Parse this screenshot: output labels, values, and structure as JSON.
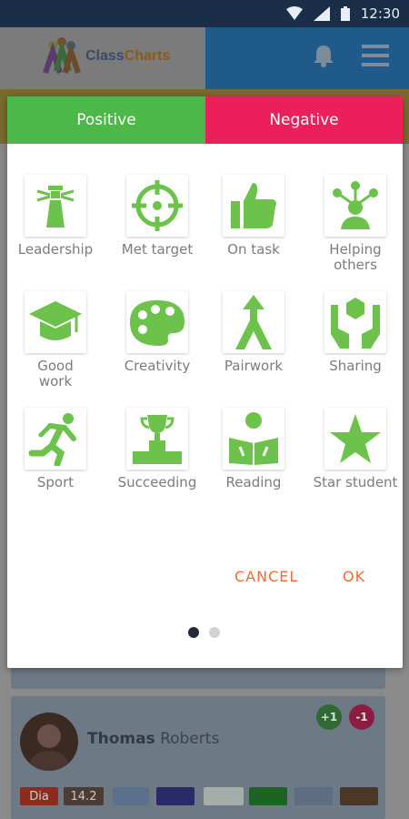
{
  "status_bar": {
    "time": "12:30"
  },
  "app_header": {
    "logo_class": "Class",
    "logo_charts": "Charts"
  },
  "dialog": {
    "tabs": [
      {
        "label": "Positive",
        "color": "#4cb847"
      },
      {
        "label": "Negative",
        "color": "#ea1f5c"
      }
    ],
    "behaviours": [
      {
        "label": "Leadership",
        "icon": "lighthouse-icon"
      },
      {
        "label": "Met target",
        "icon": "target-icon"
      },
      {
        "label": "On task",
        "icon": "thumbs-up-icon"
      },
      {
        "label": "Helping others",
        "icon": "people-network-icon"
      },
      {
        "label": "Good work",
        "icon": "graduation-cap-icon"
      },
      {
        "label": "Creativity",
        "icon": "palette-icon"
      },
      {
        "label": "Pairwork",
        "icon": "merging-arrows-icon"
      },
      {
        "label": "Sharing",
        "icon": "hands-icon"
      },
      {
        "label": "Sport",
        "icon": "runner-icon"
      },
      {
        "label": "Succeeding",
        "icon": "trophy-podium-icon"
      },
      {
        "label": "Reading",
        "icon": "reader-icon"
      },
      {
        "label": "Star student",
        "icon": "star-icon"
      }
    ],
    "cancel_label": "CANCEL",
    "ok_label": "OK",
    "page_indicator": {
      "current": 1,
      "total": 2
    }
  },
  "student_card": {
    "first_name": "Thomas",
    "last_name": "Roberts",
    "plus_label": "+1",
    "minus_label": "-1",
    "tag_label": "Dia",
    "score": "14.2"
  },
  "colors": {
    "positive": "#4cb847",
    "negative": "#ea1f5c",
    "icon_green": "#6cc24a",
    "action": "#f26a3a"
  }
}
